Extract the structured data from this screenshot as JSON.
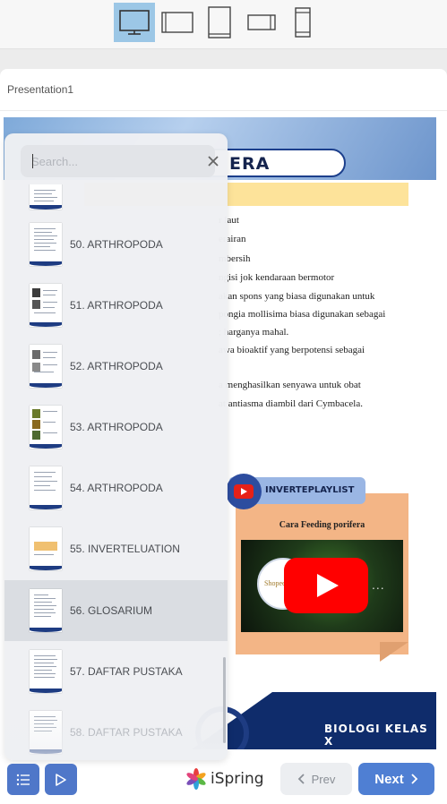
{
  "device_bar": {
    "devices": [
      {
        "icon": "desktop-monitor-icon",
        "active": true
      },
      {
        "icon": "tablet-landscape-icon",
        "active": false
      },
      {
        "icon": "tablet-portrait-icon",
        "active": false
      },
      {
        "icon": "phone-landscape-icon",
        "active": false
      },
      {
        "icon": "phone-portrait-icon",
        "active": false
      }
    ],
    "active_color": "#9cc7e6"
  },
  "presentation": {
    "title": "Presentation1"
  },
  "slide": {
    "heading": "ERA",
    "body_lines": [
      "r laut",
      "erairan",
      "mbersih",
      "ngisi jok kendaraan bermotor",
      "akan spons yang biasa digunakan untuk",
      "pongia mollisima biasa digunakan sebagai",
      "; harganya mahal.",
      "awa bioaktif yang berpotensi sebagai",
      "",
      "a menghasilkan senyawa untuk obat",
      "at antiasma diambil dari Cymbacela."
    ],
    "playlist_label": "INVERTEPLAYLIST",
    "video_caption": "Cara Feeding porifera",
    "video_logo_text": "Shopee",
    "video_more": "...",
    "footer_label": "BIOLOGI KELAS X",
    "colors": {
      "heading_border": "#1c3f8c",
      "band": "#fde39a",
      "card": "#f3b586",
      "footer": "#0f2c6b",
      "youtube_red": "#ff0000"
    }
  },
  "outline": {
    "search_placeholder": "Search...",
    "search_value": "",
    "items": [
      {
        "label": "",
        "selected": false
      },
      {
        "label": "50. ARTHROPODA",
        "selected": false
      },
      {
        "label": "51. ARTHROPODA",
        "selected": false
      },
      {
        "label": "52. ARTHROPODA",
        "selected": false
      },
      {
        "label": "53. ARTHROPODA",
        "selected": false
      },
      {
        "label": "54. ARTHROPODA",
        "selected": false
      },
      {
        "label": "55. INVERTELUATION",
        "selected": false
      },
      {
        "label": "56. GLOSARIUM",
        "selected": true
      },
      {
        "label": "57. DAFTAR PUSTAKA",
        "selected": false
      },
      {
        "label": "58. DAFTAR PUSTAKA",
        "selected": false
      }
    ]
  },
  "toolbar": {
    "outline_button_icon": "outline-list-icon",
    "play_button_icon": "play-icon",
    "logo_text": "iSpring",
    "prev_label": "Prev",
    "next_label": "Next",
    "accent": "#4f7fd3"
  }
}
